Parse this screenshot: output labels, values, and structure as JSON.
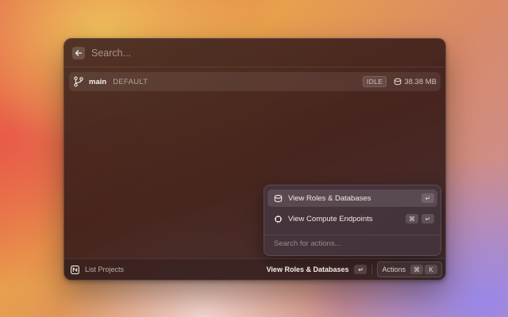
{
  "search": {
    "placeholder": "Search..."
  },
  "branch_row": {
    "name": "main",
    "label": "DEFAULT",
    "status": "IDLE",
    "size": "38.38 MB"
  },
  "actions_panel": {
    "items": [
      {
        "label": "View Roles & Databases",
        "icon": "database-icon",
        "shortcut": [
          "↵"
        ],
        "selected": true
      },
      {
        "label": "View Compute Endpoints",
        "icon": "chip-icon",
        "shortcut": [
          "⌘",
          "↵"
        ],
        "selected": false
      }
    ],
    "search_placeholder": "Search for actions..."
  },
  "footer": {
    "nav_title": "List Projects",
    "primary_action": "View Roles & Databases",
    "primary_key": "↵",
    "actions_label": "Actions",
    "actions_keys": [
      "⌘",
      "K"
    ]
  },
  "colors": {
    "window_bg": "#3e1e1a",
    "panel_bg": "#46343c",
    "text": "#ece6e2"
  }
}
